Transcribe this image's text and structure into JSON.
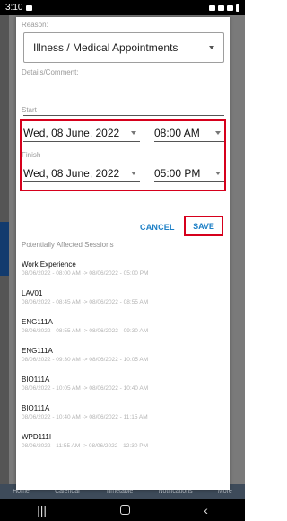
{
  "status_bar": {
    "time": "3:10"
  },
  "dialog": {
    "reason_label": "Reason:",
    "reason_value": "Illness / Medical Appointments",
    "details_label": "Details/Comment:",
    "start_label": "Start",
    "start_date": "Wed, 08 June, 2022",
    "start_time": "08:00 AM",
    "finish_label": "Finish",
    "finish_date": "Wed, 08 June, 2022",
    "finish_time": "05:00 PM",
    "cancel_label": "CANCEL",
    "save_label": "SAVE",
    "sessions_title": "Potentially Affected Sessions",
    "sessions": [
      {
        "name": "Work Experience",
        "time": "08/06/2022 - 08:00 AM -> 08/06/2022 - 05:00 PM"
      },
      {
        "name": "LAV01",
        "time": "08/06/2022 - 08:45 AM -> 08/06/2022 - 08:55 AM"
      },
      {
        "name": "ENG111A",
        "time": "08/06/2022 - 08:55 AM -> 08/06/2022 - 09:30 AM"
      },
      {
        "name": "ENG111A",
        "time": "08/06/2022 - 09:30 AM -> 08/06/2022 - 10:05 AM"
      },
      {
        "name": "BIO111A",
        "time": "08/06/2022 - 10:05 AM -> 08/06/2022 - 10:40 AM"
      },
      {
        "name": "BIO111A",
        "time": "08/06/2022 - 10:40 AM -> 08/06/2022 - 11:15 AM"
      },
      {
        "name": "WPD111I",
        "time": "08/06/2022 - 11:55 AM -> 08/06/2022 - 12:30 PM"
      }
    ]
  },
  "background": {
    "tabs": [
      "Home",
      "Calendar",
      "Timetable",
      "Notifications",
      "More"
    ]
  },
  "colors": {
    "highlight": "#d6001c",
    "accent": "#1c7fc6"
  }
}
